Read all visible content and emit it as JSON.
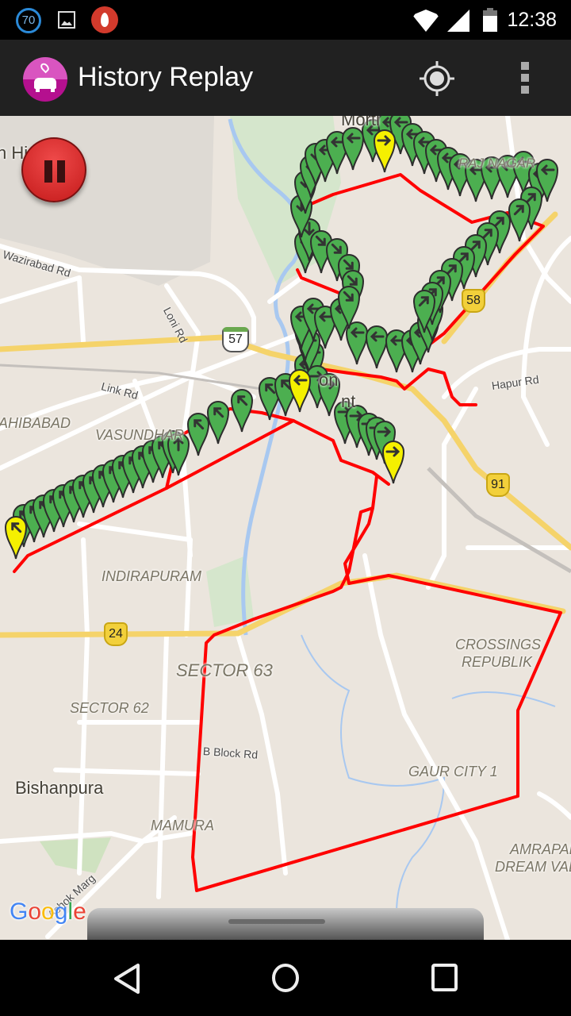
{
  "status_bar": {
    "notification_icons": [
      "speed-70-icon",
      "image-icon",
      "flame-app-icon"
    ],
    "speed_badge": "70",
    "time": "12:38",
    "system_icons": [
      "wifi-icon",
      "cellular-signal-icon",
      "battery-icon"
    ]
  },
  "app_bar": {
    "title": "History Replay",
    "app_icon": "car-location-icon",
    "actions": [
      "my-location-icon",
      "overflow-menu-icon"
    ]
  },
  "map": {
    "playback_state": "playing",
    "pause_button_icon": "pause-icon",
    "labels": {
      "morti": "Morti",
      "hin": "n Hi",
      "wazirabad": "Wazirabad Rd",
      "loni": "Loni Rd",
      "raj_nagar": "RAJ NAGAR",
      "link_rd": "Link Rd",
      "sahibabad": "AHIBABAD",
      "vasundhara": "VASUNDHAR",
      "hindon_1": "on",
      "hindon_2": "nt",
      "hapur": "Hapur Rd",
      "indirapuram": "INDIRAPURAM",
      "sector63": "SECTOR 63",
      "sector62": "SECTOR 62",
      "crossings1": "CROSSINGS",
      "crossings2": "REPUBLIK",
      "b_block": "B Block Rd",
      "bishanpura": "Bishanpura",
      "gaur": "GAUR CITY 1",
      "mamura": "MAMURA",
      "ashok": "Ashok Marg",
      "amrapali1": "AMRAPAL",
      "amrapali2": "DREAM VALL"
    },
    "shields": {
      "nh57": "57",
      "nh58": "58",
      "nh91": "91",
      "nh24": "24"
    },
    "attribution": "Google",
    "route_color": "#ff0000",
    "marker_color": "#4caf50",
    "highlight_marker_color": "#f5f000"
  },
  "nav_bar": {
    "back": "back-icon",
    "home": "home-icon",
    "recents": "recents-icon"
  }
}
